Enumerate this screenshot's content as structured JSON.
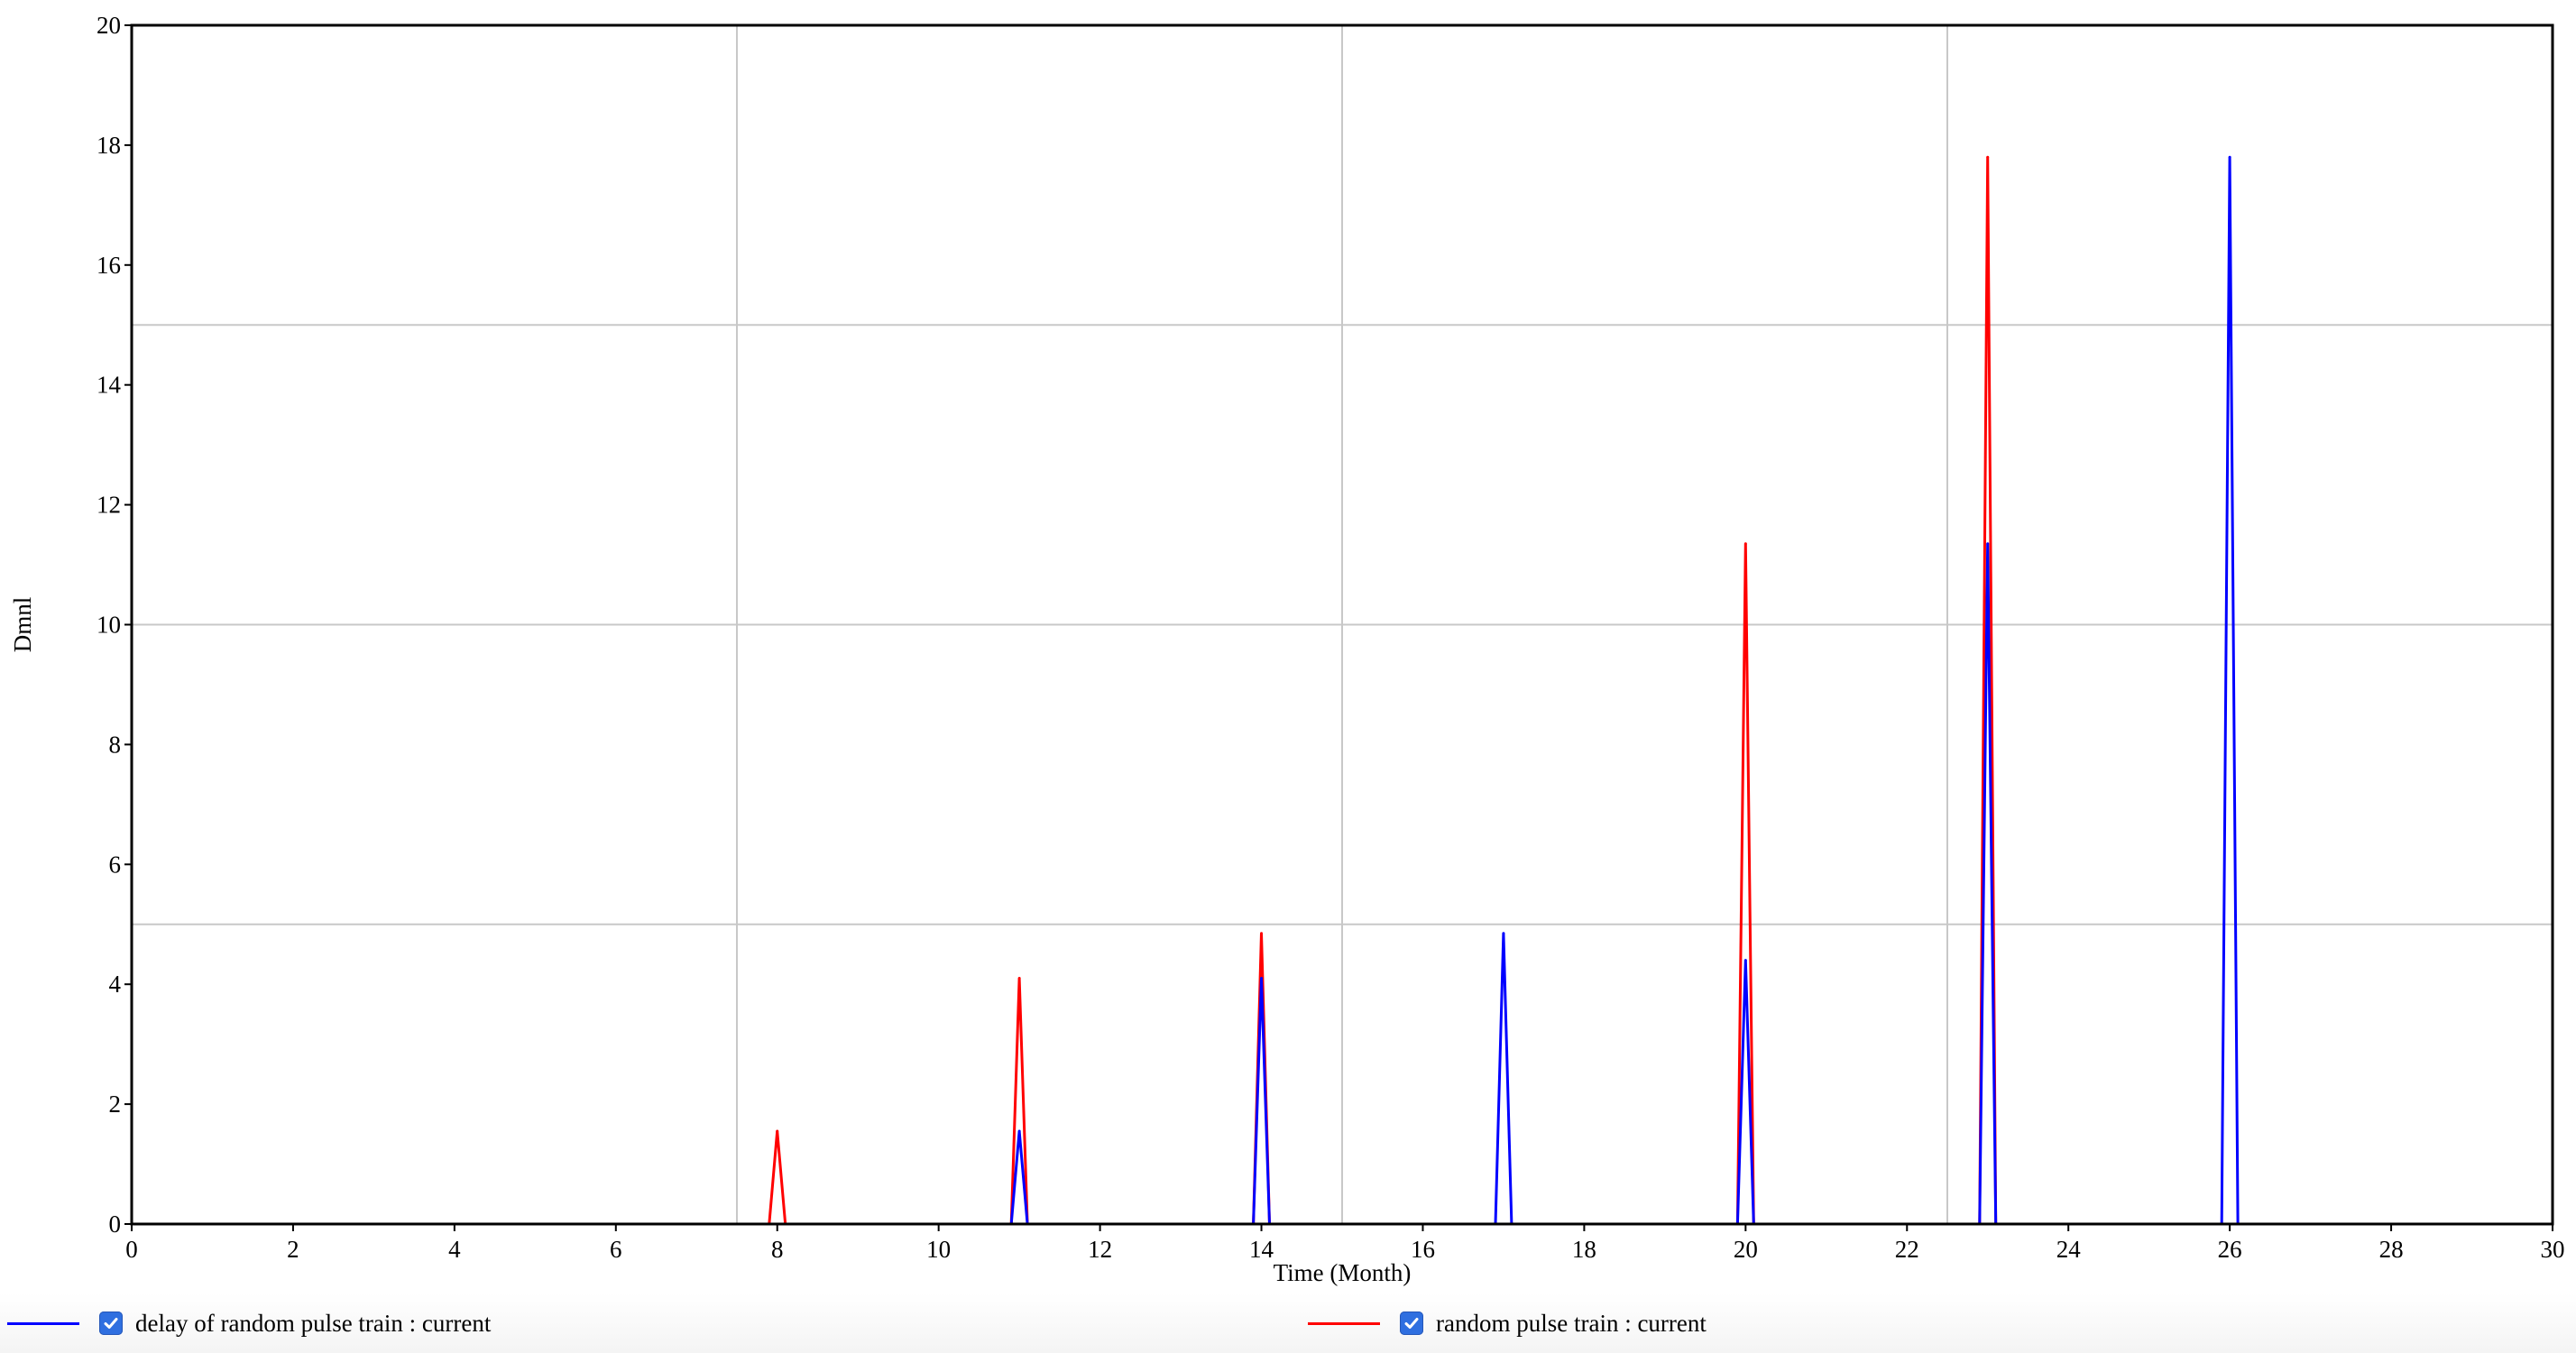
{
  "chart_data": {
    "type": "line",
    "title": "",
    "xlabel": "Time (Month)",
    "ylabel": "Dmnl",
    "xlim": [
      0,
      30
    ],
    "ylim": [
      0,
      20
    ],
    "x_ticks": [
      0,
      2,
      4,
      6,
      8,
      10,
      12,
      14,
      16,
      18,
      20,
      22,
      24,
      26,
      28,
      30
    ],
    "y_ticks": [
      0,
      2,
      4,
      6,
      8,
      10,
      12,
      14,
      16,
      18,
      20
    ],
    "grid": {
      "x": [
        7.5,
        15,
        22.5
      ],
      "y": [
        5,
        10,
        15
      ]
    },
    "legend_position": "bottom",
    "series": [
      {
        "name": "random pulse train : current",
        "color": "#ff0000",
        "pulses": [
          {
            "x": 8,
            "y": 1.55
          },
          {
            "x": 11,
            "y": 4.1
          },
          {
            "x": 14,
            "y": 4.85
          },
          {
            "x": 20,
            "y": 11.35
          },
          {
            "x": 23,
            "y": 17.8
          }
        ]
      },
      {
        "name": "delay of random pulse train : current",
        "color": "#0000ff",
        "pulses": [
          {
            "x": 11,
            "y": 1.55
          },
          {
            "x": 14,
            "y": 4.1
          },
          {
            "x": 17,
            "y": 4.85
          },
          {
            "x": 20,
            "y": 4.4
          },
          {
            "x": 23,
            "y": 11.35
          },
          {
            "x": 26,
            "y": 17.8
          }
        ]
      }
    ]
  },
  "legend": {
    "items": [
      {
        "label": "delay of random pulse train : current",
        "color": "#0000ff",
        "checked": true
      },
      {
        "label": "random pulse train : current",
        "color": "#ff0000",
        "checked": true
      }
    ]
  }
}
